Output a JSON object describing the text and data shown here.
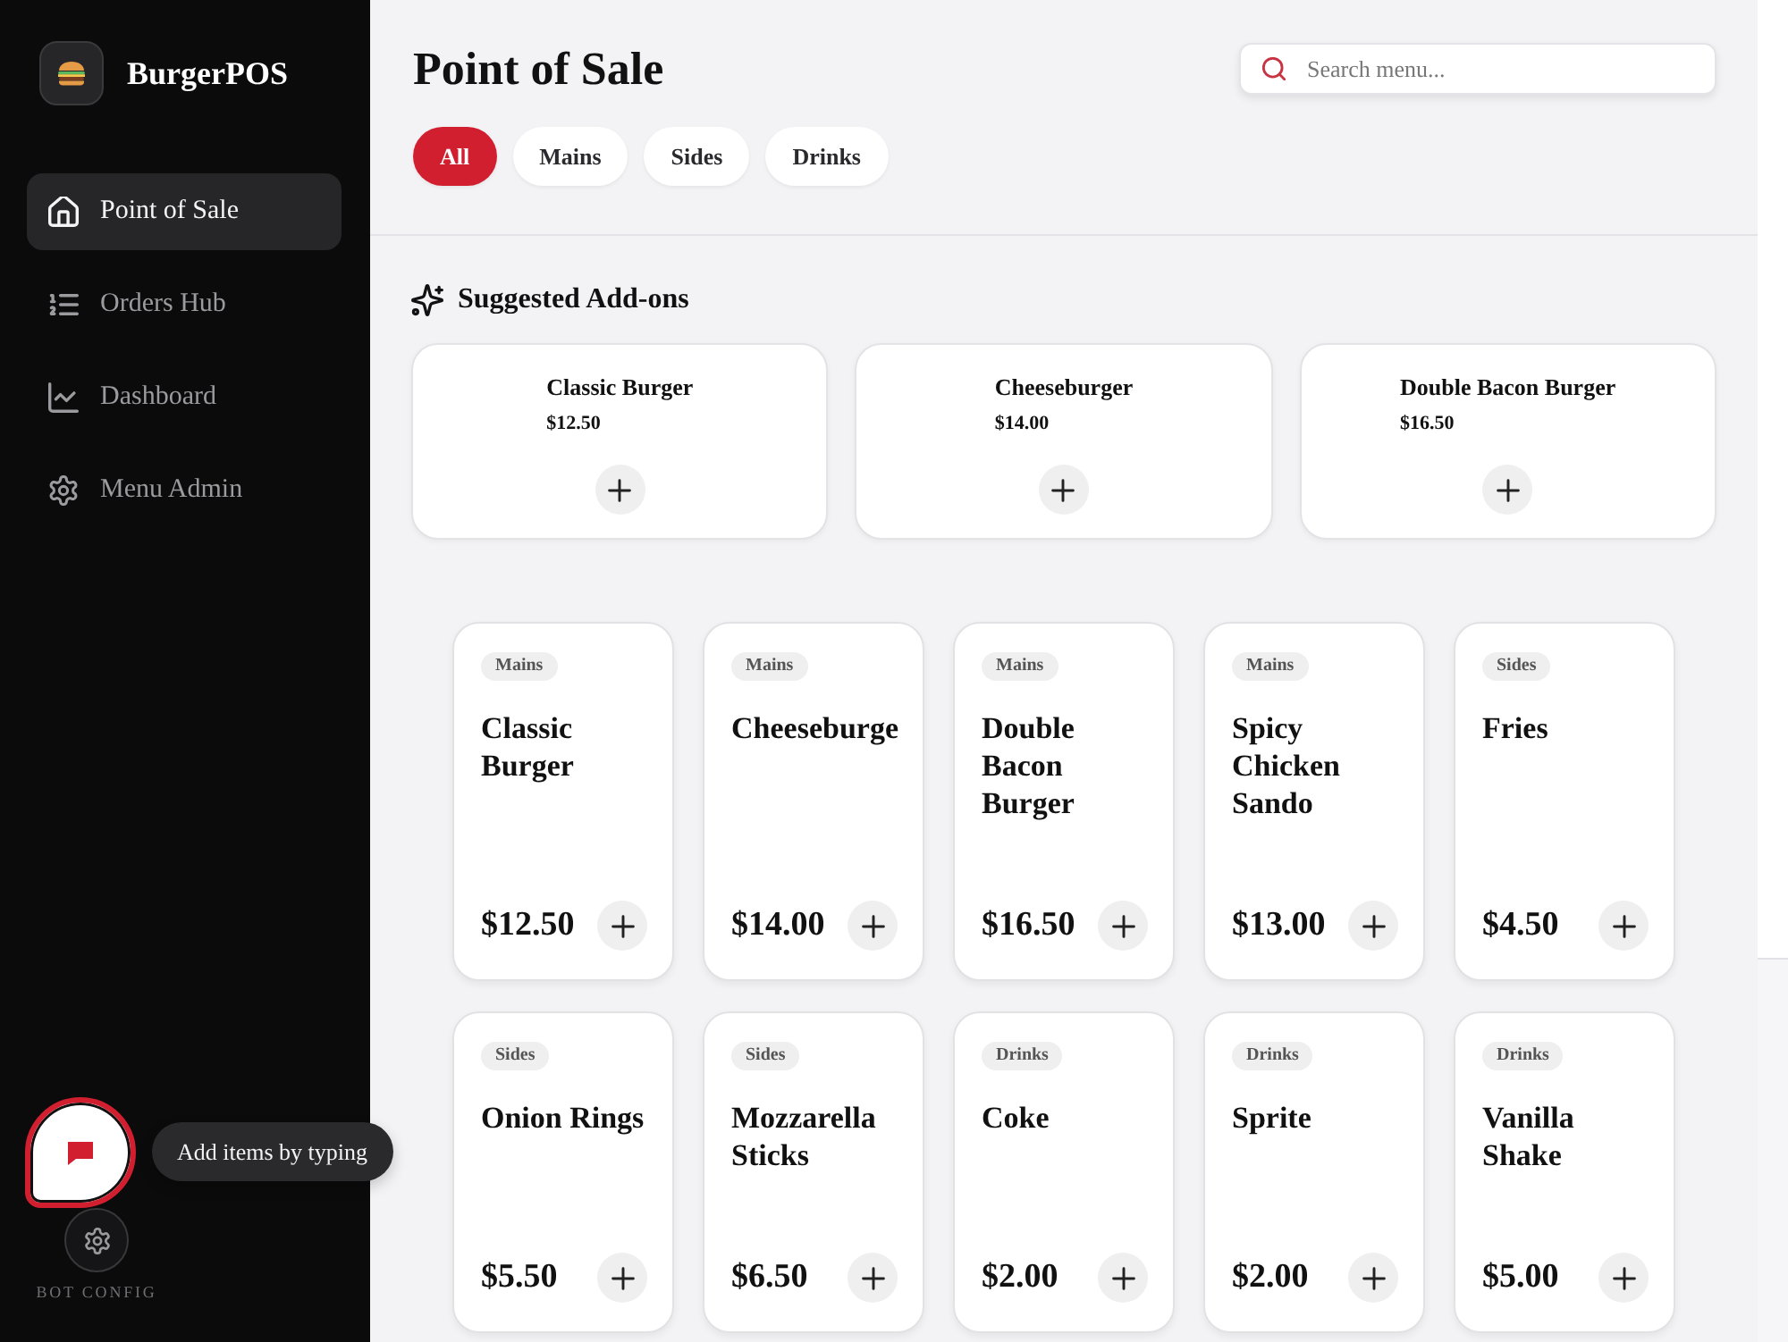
{
  "sidebar": {
    "brand": "BurgerPOS",
    "nav": [
      {
        "label": "Point of Sale",
        "selected": true
      },
      {
        "label": "Orders Hub",
        "selected": false
      },
      {
        "label": "Dashboard",
        "selected": false
      },
      {
        "label": "Menu Admin",
        "selected": false
      }
    ],
    "bot_config": {
      "label": "BOT CONFIG"
    }
  },
  "chat_widget": {
    "tooltip": "Add items by typing"
  },
  "header": {
    "title": "Point of Sale",
    "search": {
      "placeholder": "Search menu..."
    },
    "filters": [
      {
        "label": "All",
        "selected": true
      },
      {
        "label": "Mains",
        "selected": false
      },
      {
        "label": "Sides",
        "selected": false
      },
      {
        "label": "Drinks",
        "selected": false
      }
    ]
  },
  "suggested": {
    "title": "Suggested Add-ons",
    "items": [
      {
        "name": "Classic Burger",
        "price": "$12.50"
      },
      {
        "name": "Cheeseburger",
        "price": "$14.00"
      },
      {
        "name": "Double Bacon Burger",
        "price": "$16.50"
      }
    ]
  },
  "products": [
    {
      "category": "Mains",
      "name": "Classic Burger",
      "price": "$12.50"
    },
    {
      "category": "Mains",
      "name": "Cheeseburge",
      "price": "$14.00"
    },
    {
      "category": "Mains",
      "name": "Double Bacon Burger",
      "price": "$16.50"
    },
    {
      "category": "Mains",
      "name": "Spicy Chicken Sando",
      "price": "$13.00"
    },
    {
      "category": "Sides",
      "name": "Fries",
      "price": "$4.50"
    },
    {
      "category": "Sides",
      "name": "Onion Rings",
      "price": "$5.50"
    },
    {
      "category": "Sides",
      "name": "Mozzarella Sticks",
      "price": "$6.50"
    },
    {
      "category": "Drinks",
      "name": "Coke",
      "price": "$2.00"
    },
    {
      "category": "Drinks",
      "name": "Sprite",
      "price": "$2.00"
    },
    {
      "category": "Drinks",
      "name": "Vanilla Shake",
      "price": "$5.00"
    }
  ]
}
